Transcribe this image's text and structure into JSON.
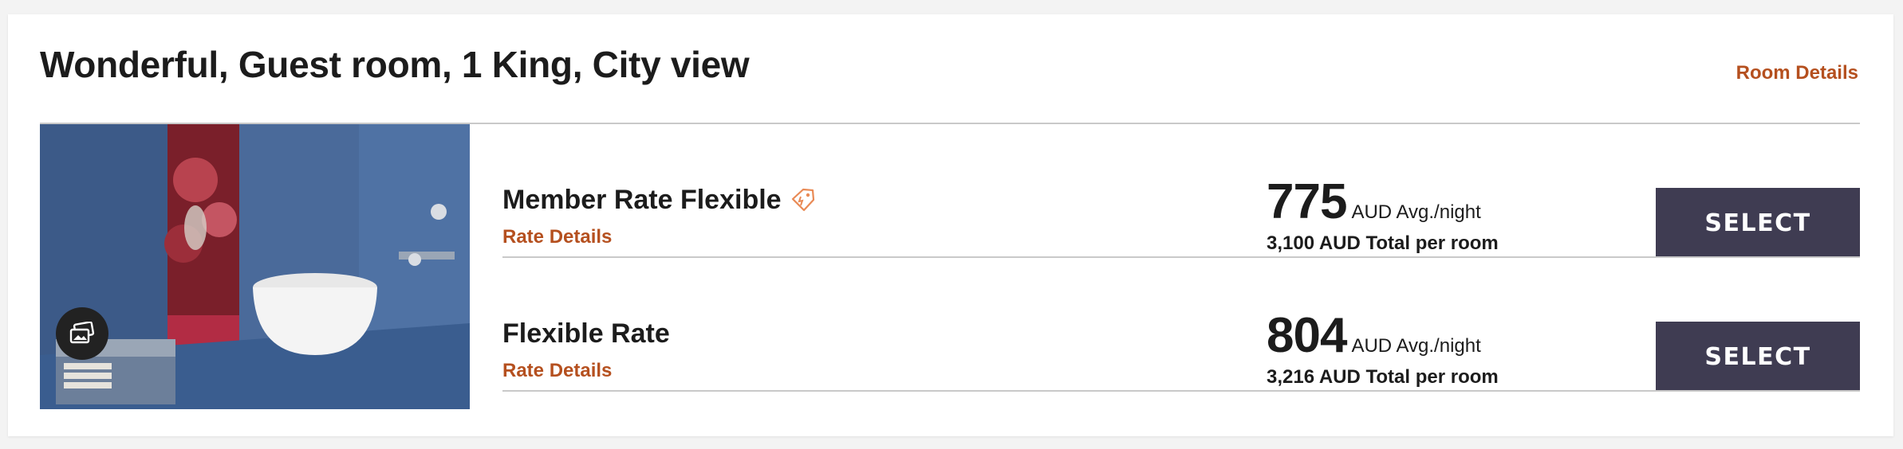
{
  "room": {
    "title": "Wonderful, Guest room, 1 King, City view",
    "details_link": "Room Details"
  },
  "rates": [
    {
      "name": "Member Rate Flexible",
      "details_link": "Rate Details",
      "price": "775",
      "price_unit": "AUD Avg./night",
      "total": "3,100 AUD Total per room",
      "button": "SELECT",
      "member_tag_icon": "tag-icon"
    },
    {
      "name": "Flexible Rate",
      "details_link": "Rate Details",
      "price": "804",
      "price_unit": "AUD Avg./night",
      "total": "3,216 AUD Total per room",
      "button": "SELECT"
    }
  ],
  "colors": {
    "accent": "#b5501f",
    "button_bg": "#3f3c52",
    "text": "#1c1c1c",
    "divider": "#c9c9c9",
    "tag_icon": "#e98a55"
  },
  "photo": {
    "gallery_icon": "image-gallery-icon"
  }
}
